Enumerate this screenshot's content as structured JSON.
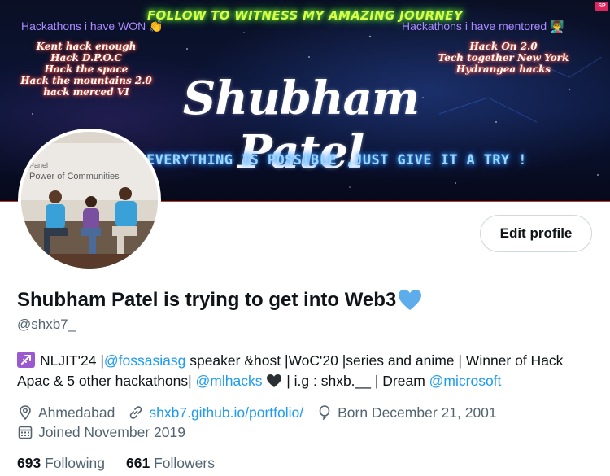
{
  "banner": {
    "headline": "FOLLOW TO WITNESS MY AMAZING JOURNEY",
    "won_title": "Hackathons i have WON",
    "won_emoji": "👏",
    "won_list": [
      "Kent hack enough",
      "Hack D.P.O.C",
      "Hack the space",
      "Hack the mountains 2.0",
      "hack merced VI"
    ],
    "mentor_title": "Hackathons i have mentored",
    "mentor_emoji": "👨‍🏫",
    "mentor_list": [
      "Hack On 2.0",
      "Tech together New York",
      "Hydrangea hacks"
    ],
    "name": "Shubham Patel",
    "motto": "EVERYTHING IS POSSIBLE ,JUST GIVE IT A TRY !",
    "badge": "SP"
  },
  "avatar": {
    "slide_line1": "Panel",
    "slide_line2": "Power of Communities"
  },
  "edit_profile_label": "Edit profile",
  "profile": {
    "display_name": "Shubham Patel is trying to get into Web3",
    "handle": "@shxb7_"
  },
  "bio": {
    "t1": "NLJIT'24 |",
    "m1": "@fossasiasg",
    "t2": " speaker &host |WoC'20 |series and anime | Winner of Hack Apac & 5 other hackathons| ",
    "m2": "@mlhacks",
    "t3": " | i.g : shxb.__ | Dream ",
    "m3": "@microsoft"
  },
  "meta": {
    "location": "Ahmedabad",
    "website": "shxb7.github.io/portfolio/",
    "born": "Born December 21, 2001",
    "joined": "Joined November 2019"
  },
  "stats": {
    "following_count": "693",
    "following_label": "Following",
    "followers_count": "661",
    "followers_label": "Followers"
  },
  "colors": {
    "accent": "#1d9bf0",
    "secondary_text": "#536471",
    "primary_text": "#0f1419"
  }
}
